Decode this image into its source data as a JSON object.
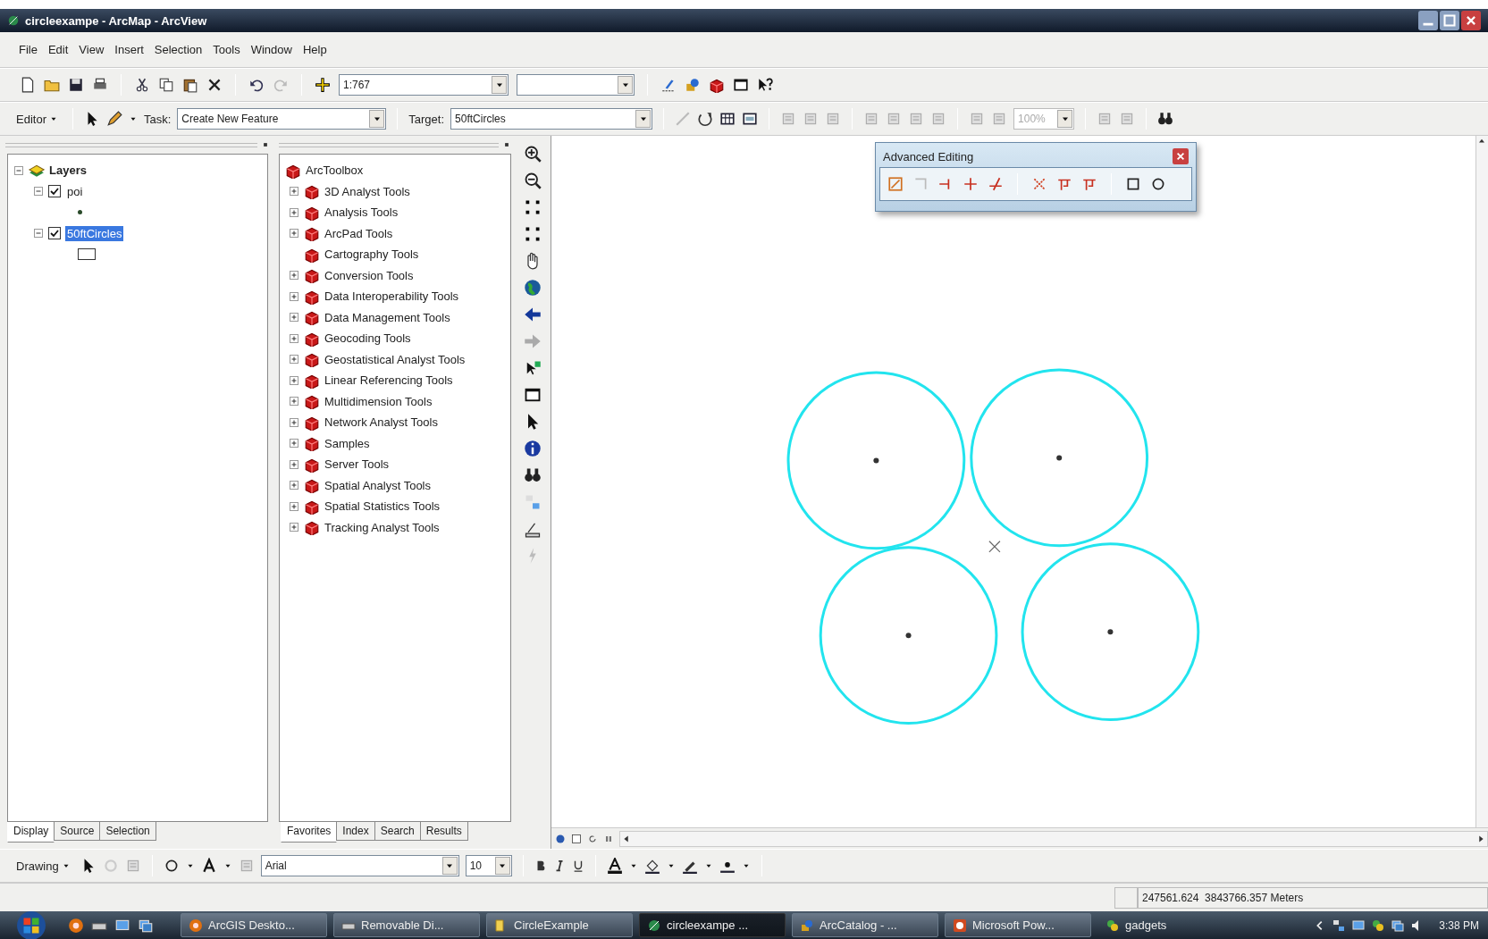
{
  "window": {
    "title": "circleexampe - ArcMap - ArcView"
  },
  "menu": [
    "File",
    "Edit",
    "View",
    "Insert",
    "Selection",
    "Tools",
    "Window",
    "Help"
  ],
  "standard_toolbar": {
    "scale": "1:767"
  },
  "editor_toolbar": {
    "editor": "Editor",
    "task_label": "Task:",
    "task": "Create New Feature",
    "target_label": "Target:",
    "target": "50ftCircles",
    "zoom": "100%"
  },
  "toc": {
    "root": {
      "label": "Layers",
      "expanded": true,
      "children": [
        {
          "label": "poi",
          "checked": true,
          "expanded": true,
          "selected": false,
          "kind": "point"
        },
        {
          "label": "50ftCircles",
          "checked": true,
          "expanded": true,
          "selected": true,
          "kind": "polygon"
        }
      ]
    },
    "tabs": [
      {
        "label": "Display",
        "selected": true
      },
      {
        "label": "Source",
        "selected": false
      },
      {
        "label": "Selection",
        "selected": false
      }
    ]
  },
  "toolbox": {
    "root": "ArcToolbox",
    "items": [
      {
        "label": "3D Analyst Tools",
        "expandable": true
      },
      {
        "label": "Analysis Tools",
        "expandable": true
      },
      {
        "label": "ArcPad Tools",
        "expandable": true
      },
      {
        "label": "Cartography Tools",
        "expandable": false
      },
      {
        "label": "Conversion Tools",
        "expandable": true
      },
      {
        "label": "Data Interoperability Tools",
        "expandable": true
      },
      {
        "label": "Data Management Tools",
        "expandable": true
      },
      {
        "label": "Geocoding Tools",
        "expandable": true
      },
      {
        "label": "Geostatistical Analyst Tools",
        "expandable": true
      },
      {
        "label": "Linear Referencing Tools",
        "expandable": true
      },
      {
        "label": "Multidimension Tools",
        "expandable": true
      },
      {
        "label": "Network Analyst Tools",
        "expandable": true
      },
      {
        "label": "Samples",
        "expandable": true
      },
      {
        "label": "Server Tools",
        "expandable": true
      },
      {
        "label": "Spatial Analyst Tools",
        "expandable": true
      },
      {
        "label": "Spatial Statistics Tools",
        "expandable": true
      },
      {
        "label": "Tracking Analyst Tools",
        "expandable": true
      }
    ],
    "tabs": [
      {
        "label": "Favorites",
        "selected": true
      },
      {
        "label": "Index",
        "selected": false
      },
      {
        "label": "Search",
        "selected": false
      },
      {
        "label": "Results",
        "selected": false
      }
    ]
  },
  "advanced_editing": {
    "title": "Advanced Editing"
  },
  "drawing_toolbar": {
    "label": "Drawing",
    "font": "Arial",
    "size": "10"
  },
  "status_bar": {
    "coordinates": "247561.624  3843766.357 Meters"
  },
  "taskbar": {
    "items": [
      {
        "label": "ArcGIS Deskto...",
        "selected": false
      },
      {
        "label": "Removable Di...",
        "selected": false
      },
      {
        "label": "CircleExample",
        "selected": false
      },
      {
        "label": "circleexampe ...",
        "selected": true
      },
      {
        "label": "ArcCatalog - ...",
        "selected": false
      },
      {
        "label": "Microsoft Pow...",
        "selected": false
      },
      {
        "label": "gadgets",
        "selected": false
      }
    ],
    "clock": "3:38 PM"
  }
}
